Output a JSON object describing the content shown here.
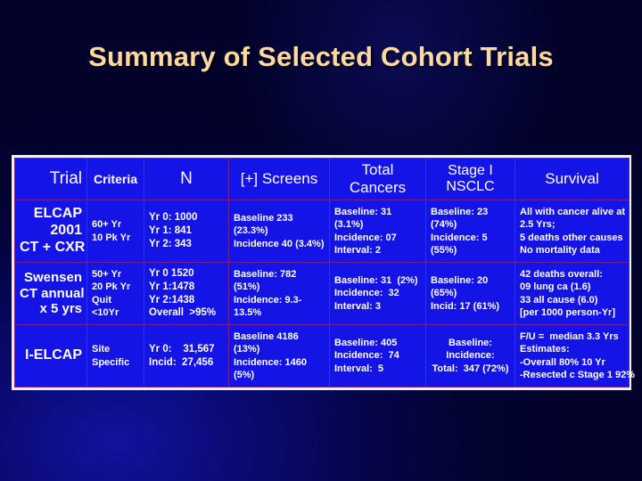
{
  "slide": {
    "title": "Summary of Selected Cohort Trials",
    "background_color": "#05054a",
    "title_color": "#ffd9a0",
    "table_fill_color": "#1414e6",
    "table_border_color": "#f2f2f2",
    "grid_color": "#7a1f8c"
  },
  "table": {
    "headers": {
      "trial": "Trial",
      "criteria": "Criteria",
      "n": "N",
      "screens": "[+] Screens",
      "total_cancers_l1": "Total",
      "total_cancers_l2": "Cancers",
      "stage_i_l1": "Stage I",
      "stage_i_l2": "NSCLC",
      "survival": "Survival"
    },
    "rows": [
      {
        "trial": [
          "ELCAP",
          "2001",
          "CT + CXR"
        ],
        "criteria": [
          "60+ Yr",
          "10 Pk Yr"
        ],
        "n": [
          "Yr 0: 1000",
          "Yr 1: 841",
          "Yr 2: 343"
        ],
        "screens": [
          "Baseline 233",
          "(23.3%)",
          "Incidence 40 (3.4%)"
        ],
        "total_cancers": [
          "Baseline: 31",
          "(3.1%)",
          "Incidence: 07",
          "Interval: 2"
        ],
        "stage_i": [
          "Baseline: 23",
          "(74%)",
          "Incidence: 5",
          "(55%)"
        ],
        "survival": [
          "All with cancer alive at",
          "2.5 Yrs;",
          "5 deaths other causes",
          "No mortality data"
        ]
      },
      {
        "trial": [
          "Swensen",
          "CT annual",
          "x 5 yrs"
        ],
        "criteria": [
          "50+ Yr",
          "20 Pk Yr",
          "Quit",
          "<10Yr"
        ],
        "n": [
          "Yr 0 1520",
          "Yr 1:1478",
          "Yr 2:1438",
          "Overall  >95%"
        ],
        "screens": [
          "Baseline: 782",
          "(51%)",
          "Incidence: 9.3-",
          "13.5%"
        ],
        "total_cancers": [
          "Baseline: 31  (2%)",
          "Incidence:  32",
          "Interval: 3"
        ],
        "stage_i": [
          "Baseline: 20",
          "(65%)",
          "Incid: 17 (61%)"
        ],
        "survival": [
          "42 deaths overall:",
          "09 lung ca (1.6)",
          "33 all cause (6.0)",
          "[per 1000 person-Yr]"
        ]
      },
      {
        "trial": [
          "I-ELCAP"
        ],
        "criteria": [
          "Site",
          "Specific"
        ],
        "n": [
          "Yr 0:    31,567",
          "Incid:  27,456"
        ],
        "screens": [
          "Baseline 4186",
          "(13%)",
          "Incidence: 1460",
          "(5%)"
        ],
        "total_cancers": [
          "Baseline: 405",
          "Incidence:  74",
          "Interval:  5"
        ],
        "stage_i": [
          "Baseline:",
          "Incidence:",
          "Total:  347 (72%)"
        ],
        "survival": [
          "F/U =  median 3.3 Yrs",
          "Estimates:",
          "-Overall 80% 10 Yr",
          "-Resected c Stage 1 92%"
        ]
      }
    ]
  }
}
